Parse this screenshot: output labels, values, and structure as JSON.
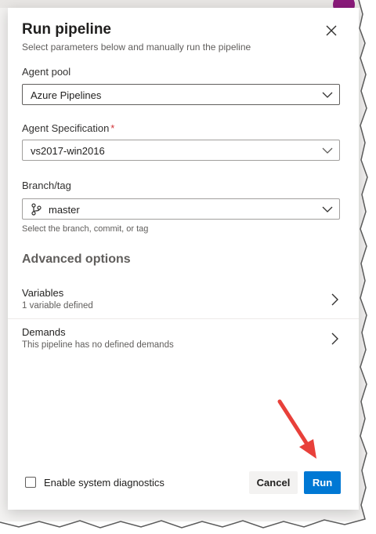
{
  "dialog": {
    "title": "Run pipeline",
    "subtitle": "Select parameters below and manually run the pipeline",
    "close_icon": "close-icon"
  },
  "fields": {
    "agent_pool": {
      "label": "Agent pool",
      "value": "Azure Pipelines"
    },
    "agent_spec": {
      "label": "Agent Specification",
      "required_mark": "*",
      "value": "vs2017-win2016"
    },
    "branch": {
      "label": "Branch/tag",
      "value": "master",
      "helper": "Select the branch, commit, or tag",
      "icon": "branch-icon"
    }
  },
  "advanced": {
    "title": "Advanced options",
    "rows": [
      {
        "title": "Variables",
        "subtitle": "1 variable defined"
      },
      {
        "title": "Demands",
        "subtitle": "This pipeline has no defined demands"
      }
    ]
  },
  "footer": {
    "diagnostics_label": "Enable system diagnostics",
    "diagnostics_checked": false,
    "cancel_label": "Cancel",
    "run_label": "Run"
  },
  "colors": {
    "primary": "#0078d4",
    "required": "#d13438",
    "annotation_arrow": "#e8403a",
    "avatar": "#8a1a7a"
  }
}
